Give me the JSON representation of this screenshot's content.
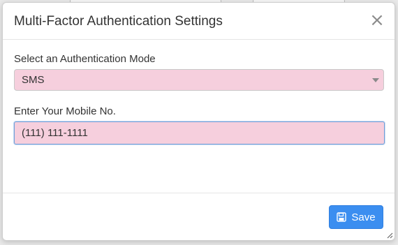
{
  "modal": {
    "title": "Multi-Factor Authentication Settings",
    "close_glyph": "×"
  },
  "auth_mode": {
    "label": "Select an Authentication Mode",
    "selected": "SMS"
  },
  "mobile": {
    "label": "Enter Your Mobile No.",
    "value": "(111) 111-1111"
  },
  "footer": {
    "save_label": "Save",
    "save_icon": "floppy-disk-icon"
  },
  "colors": {
    "field_fill": "#f6cfdd",
    "save_button": "#3b8ef0",
    "focus_border": "#6f9fd8"
  }
}
